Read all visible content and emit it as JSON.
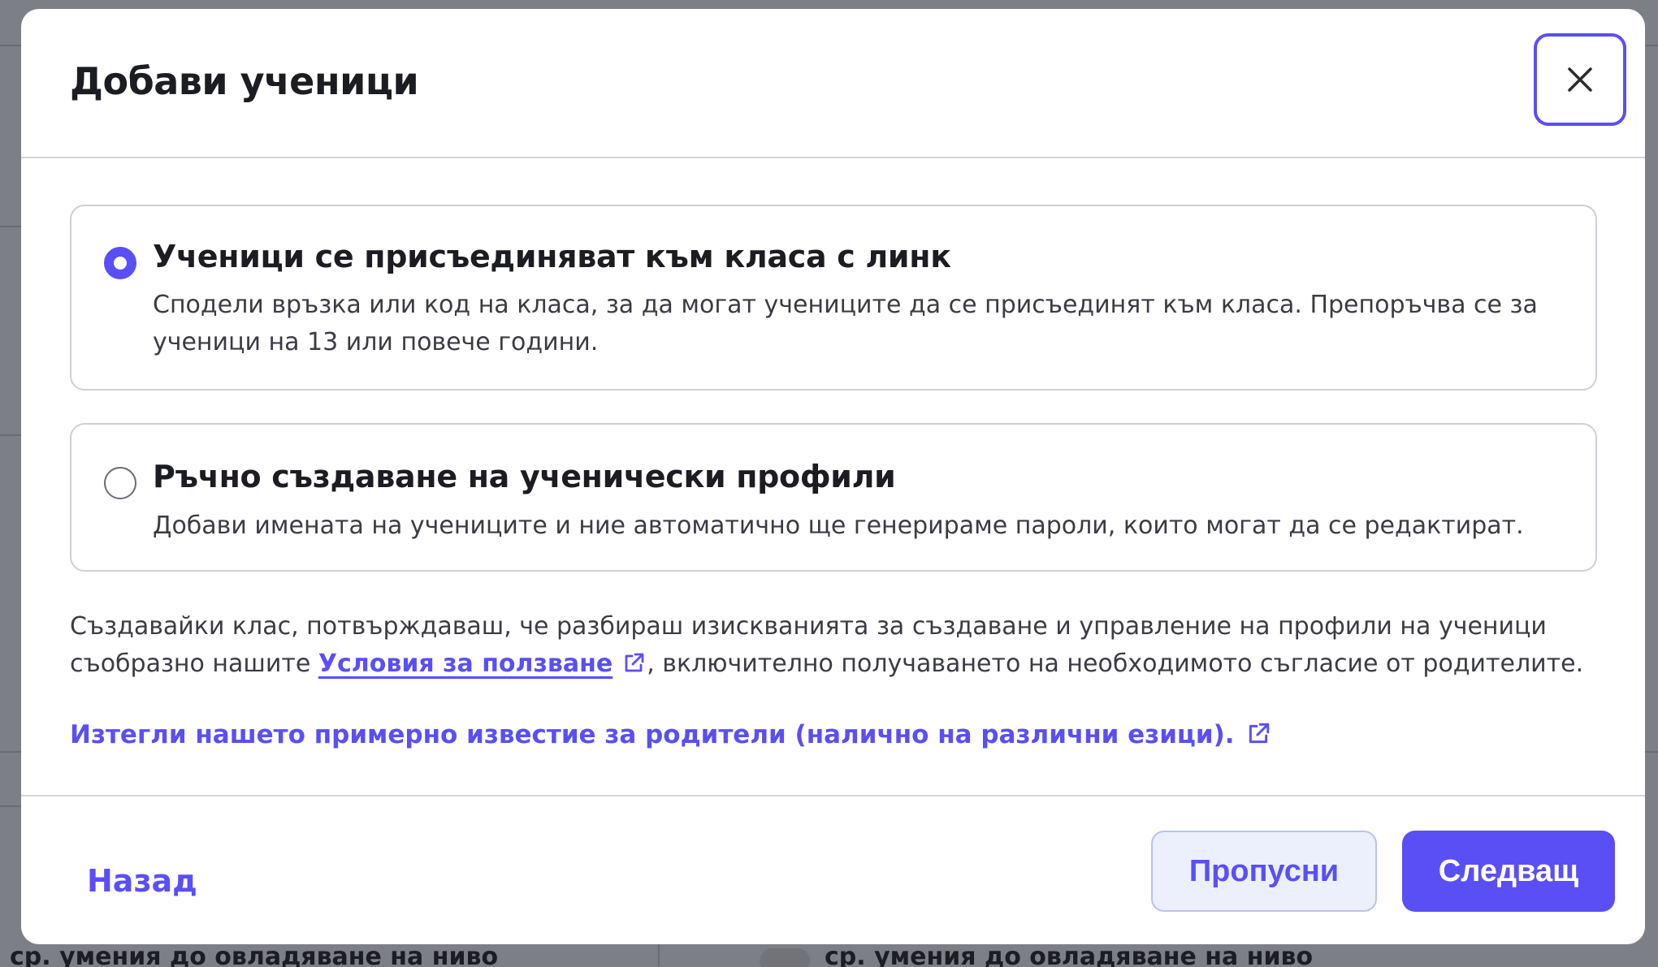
{
  "modal": {
    "title": "Добави ученици",
    "close_icon": "close-icon",
    "options": [
      {
        "title": "Ученици се присъединяват към класа с линк",
        "description": "Сподели връзка или код на класа, за да могат учениците да се присъединят към класа. Препоръчва се за ученици на 13 или повече години.",
        "selected": true
      },
      {
        "title": "Ръчно създаване на ученически профили",
        "description": "Добави имената на учениците и ние автоматично ще генерираме пароли, които могат да се редактират.",
        "selected": false
      }
    ],
    "consent": {
      "before": "Създавайки клас, потвърждаваш, че разбираш изискванията за създаване и управление на профили на ученици съобразно нашите ",
      "link": "Условия за ползване",
      "after": ", включително получаването на необходимото съгласие от родителите.",
      "link_icon": "external-link-icon"
    },
    "download_link": "Изтегли нашето примерно известие за родители (налично на различни езици).",
    "download_icon": "external-link-icon",
    "back_label": "Назад",
    "skip_label": "Пропусни",
    "next_label": "Следващ"
  },
  "background": {
    "footer_left": "ср. умения до овладяване на ниво",
    "footer_right": "ср. умения до овладяване на ниво"
  },
  "colors": {
    "accent": "#5a4ff5",
    "overlay": "#7d7f86",
    "skip_bg": "#ecf0fd"
  }
}
